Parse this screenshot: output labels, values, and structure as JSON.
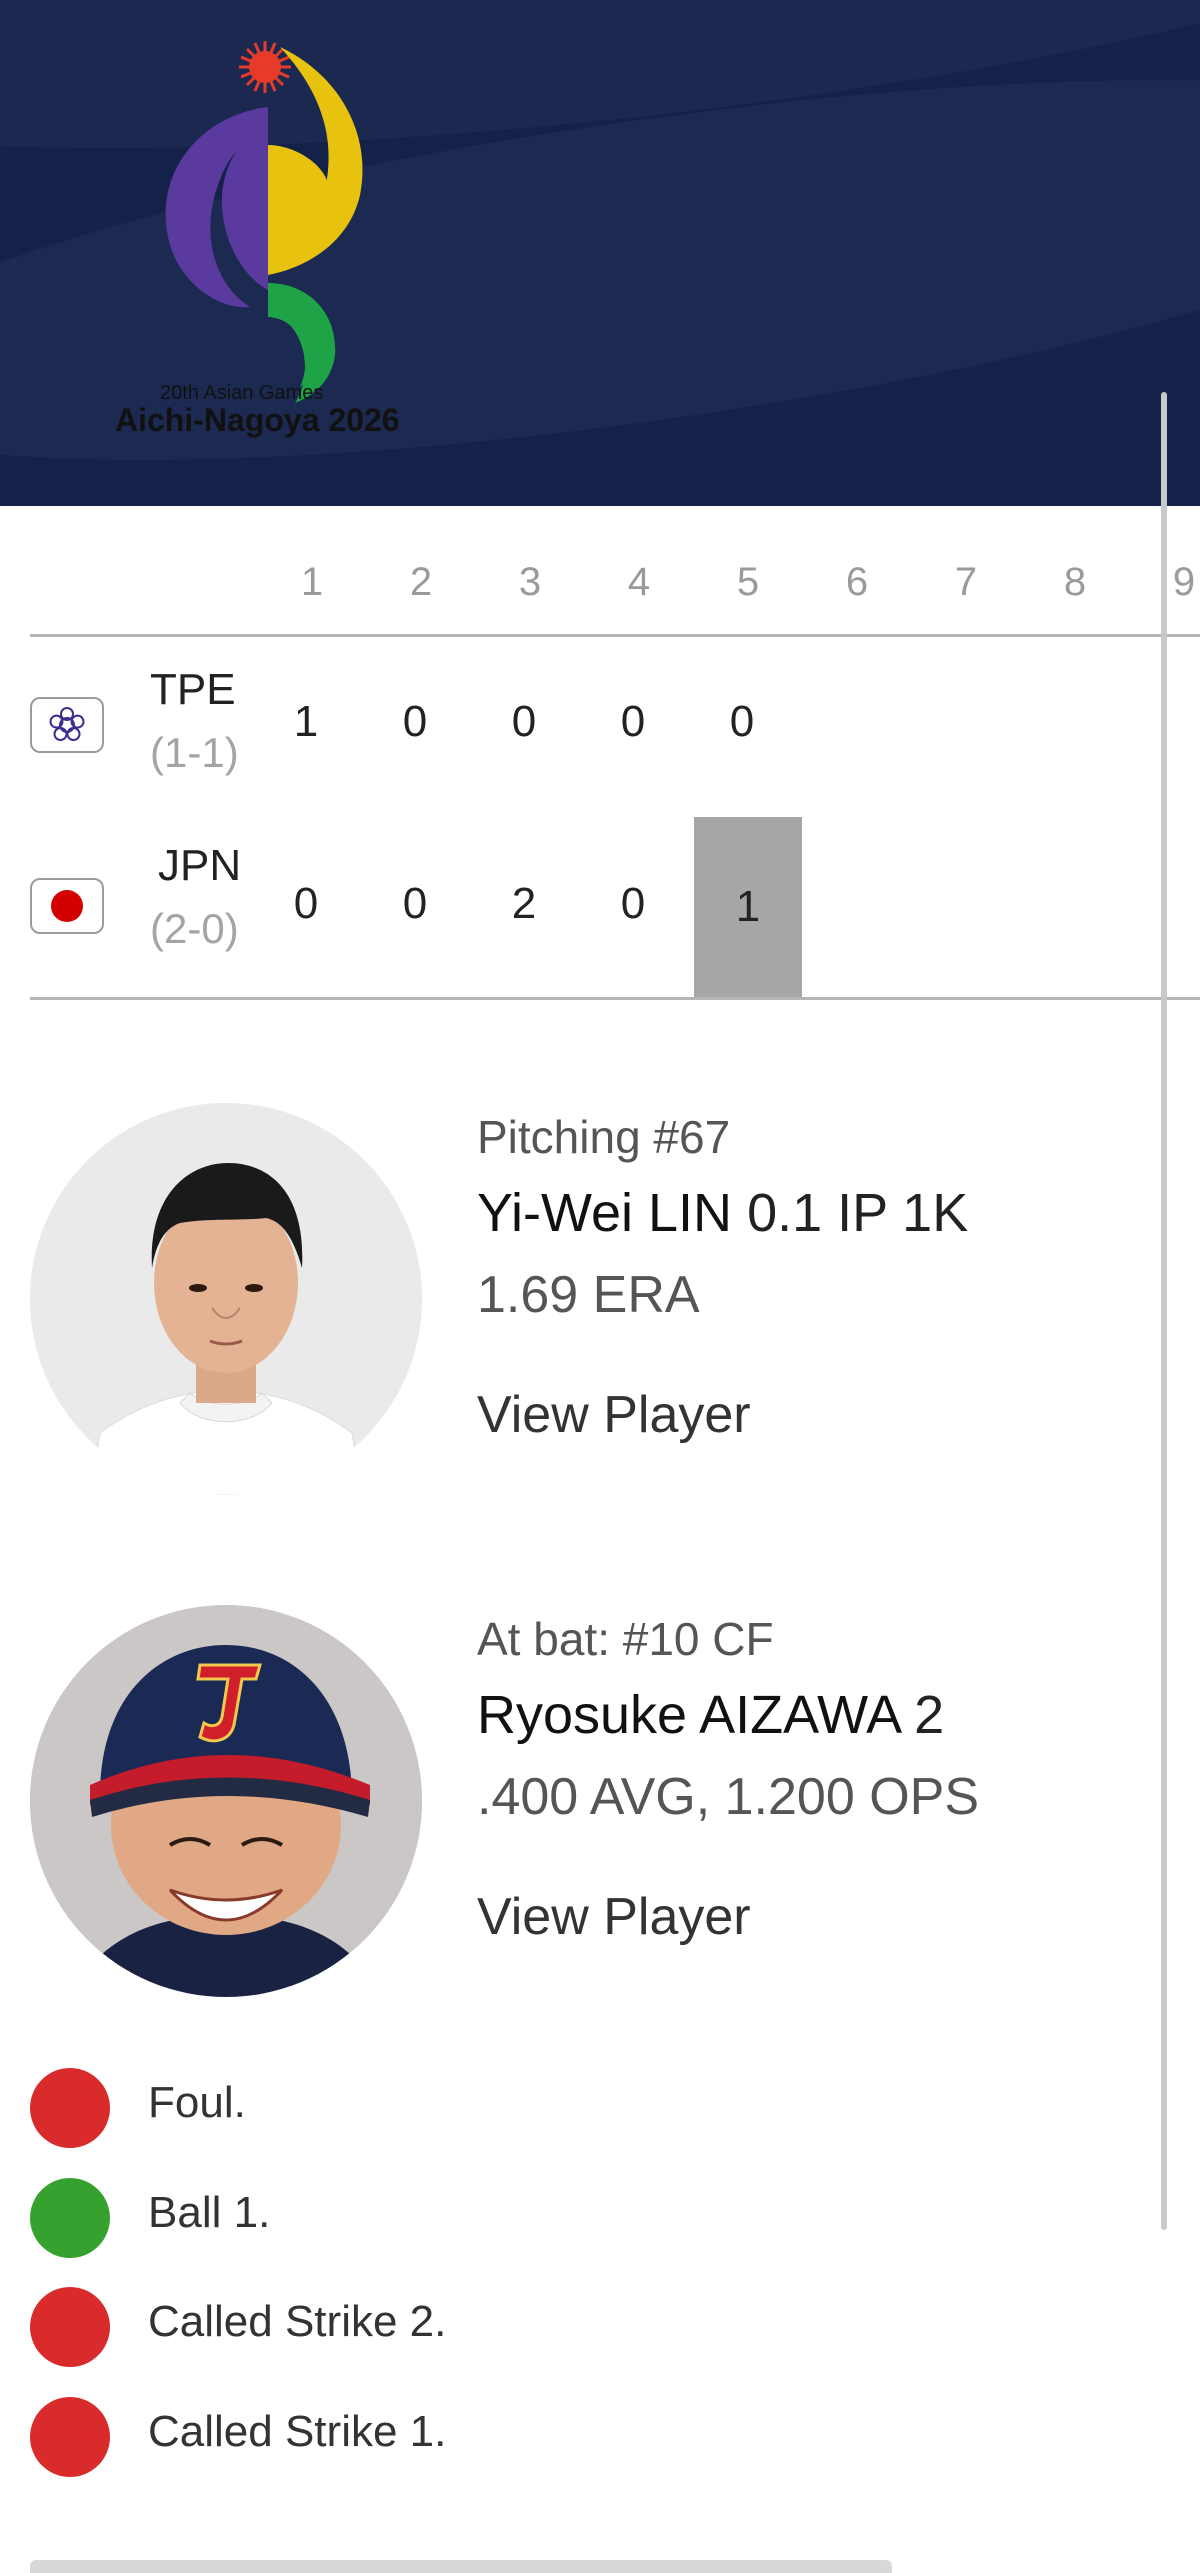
{
  "banner": {
    "logo_line1": "20th Asian Games",
    "logo_line2": "Aichi-Nagoya 2026",
    "colors": {
      "background": "#14224a",
      "purple": "#5a3a9e",
      "yellow": "#e7c20e",
      "green": "#1fa347",
      "sun": "#e63b2a"
    }
  },
  "linescore": {
    "innings": [
      "1",
      "2",
      "3",
      "4",
      "5",
      "6",
      "7",
      "8",
      "9"
    ],
    "teams": [
      {
        "code": "TPE",
        "record": "(1-1)",
        "flag": "chinese-taipei-flag-icon",
        "runs": [
          "1",
          "0",
          "0",
          "0",
          "0"
        ]
      },
      {
        "code": "JPN",
        "record": "(2-0)",
        "flag": "japan-flag-icon",
        "runs": [
          "0",
          "0",
          "2",
          "0",
          "1"
        ]
      }
    ],
    "current_inning_highlight": "#a6a6a6"
  },
  "pitcher": {
    "role": "Pitching #67",
    "name": "Yi-Wei LIN",
    "line": " 0.1 IP 1K",
    "stat": "1.69 ERA",
    "link": "View Player"
  },
  "batter": {
    "role": "At bat: #10 CF",
    "name": "Ryosuke AIZAWA",
    "line": " 2",
    "stat": ".400 AVG, 1.200 OPS",
    "link": "View Player"
  },
  "pitches": [
    {
      "label": "Foul.",
      "color": "#d92b2b"
    },
    {
      "label": "Ball 1.",
      "color": "#36a12e"
    },
    {
      "label": "Called Strike 2.",
      "color": "#d92b2b"
    },
    {
      "label": "Called Strike 1.",
      "color": "#d92b2b"
    }
  ]
}
